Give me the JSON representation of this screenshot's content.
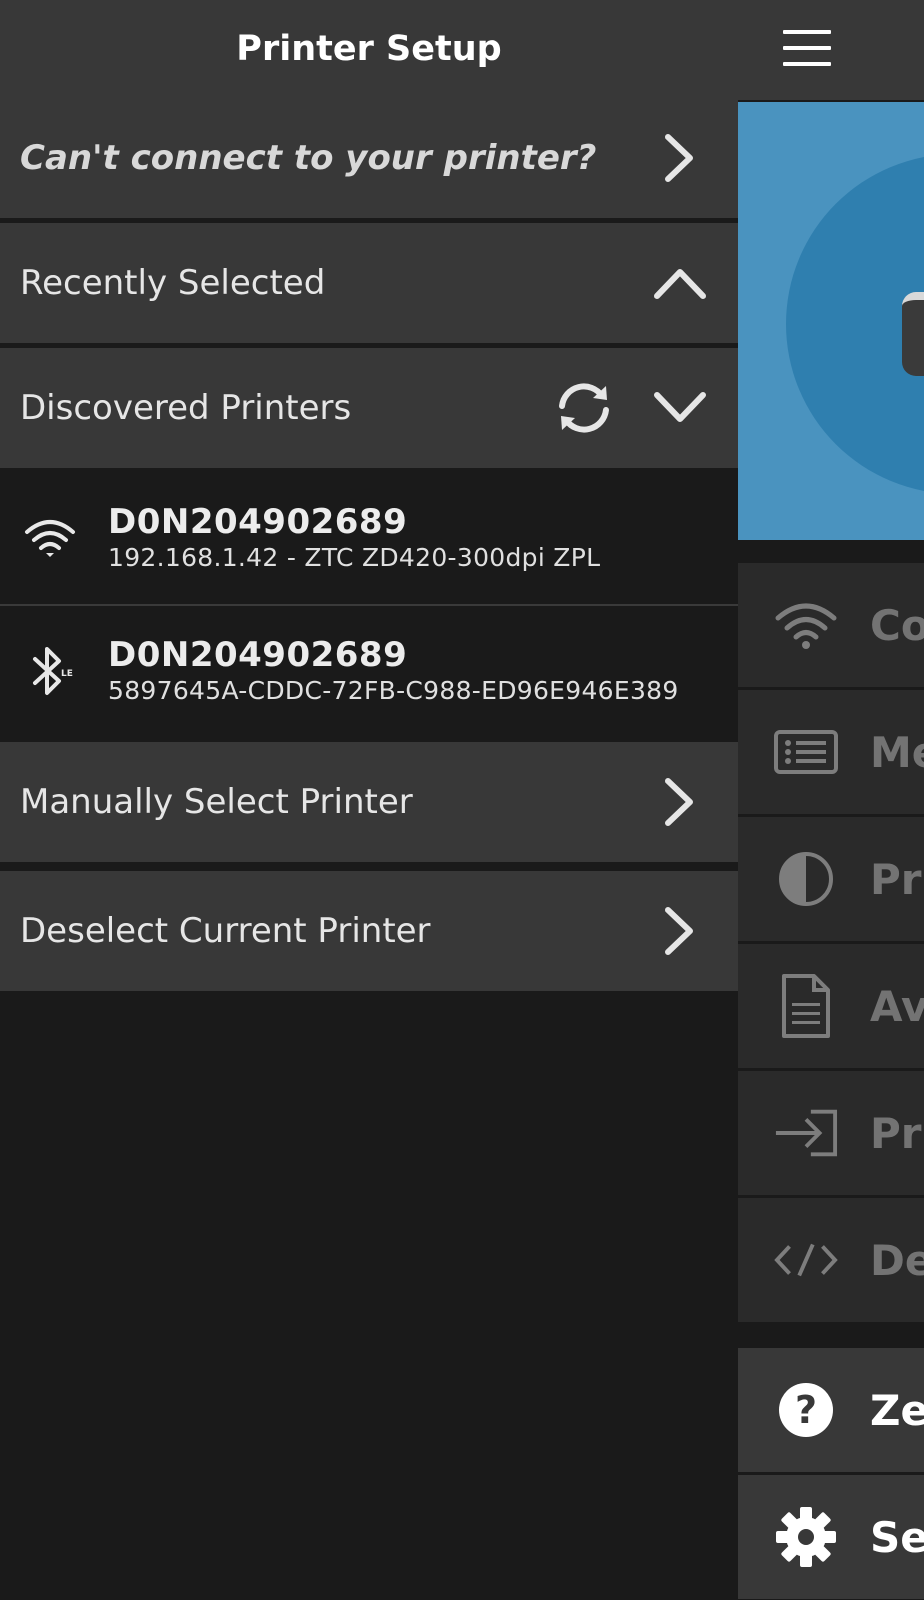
{
  "header": {
    "title": "Printer Setup",
    "menu_icon": "hamburger-icon"
  },
  "drawer": {
    "cant_connect": {
      "label": "Can't connect to your printer?",
      "icon": "chevron-right-icon"
    },
    "recently_selected": {
      "label": "Recently Selected",
      "icon": "chevron-up-icon"
    },
    "discovered": {
      "label": "Discovered Printers",
      "refresh_icon": "refresh-icon",
      "icon": "chevron-down-icon"
    },
    "printers": [
      {
        "name": "D0N204902689",
        "detail": "192.168.1.42 - ZTC ZD420-300dpi ZPL",
        "icon": "wifi-icon"
      },
      {
        "name": "D0N204902689",
        "detail": "5897645A-CDDC-72FB-C988-ED96E946E389",
        "icon": "bluetooth-le-icon",
        "icon_badge": "LE"
      }
    ],
    "manual_select": {
      "label": "Manually Select Printer",
      "icon": "chevron-right-icon"
    },
    "deselect": {
      "label": "Deselect Current Printer",
      "icon": "chevron-right-icon"
    }
  },
  "background_menu": {
    "items": [
      {
        "label": "Co",
        "icon": "wifi-icon"
      },
      {
        "label": "Me",
        "icon": "list-icon"
      },
      {
        "label": "Pri",
        "icon": "contrast-icon"
      },
      {
        "label": "Av",
        "icon": "document-icon"
      },
      {
        "label": "Pri",
        "icon": "input-arrow-icon"
      },
      {
        "label": "De",
        "icon": "code-icon"
      },
      {
        "label": "Ze",
        "icon": "help-icon"
      },
      {
        "label": "Se",
        "icon": "gear-icon"
      }
    ]
  },
  "colors": {
    "bar": "#383838",
    "background": "#1a1a1a",
    "hero": "#4a93bf",
    "text": "#e6e6e6"
  }
}
